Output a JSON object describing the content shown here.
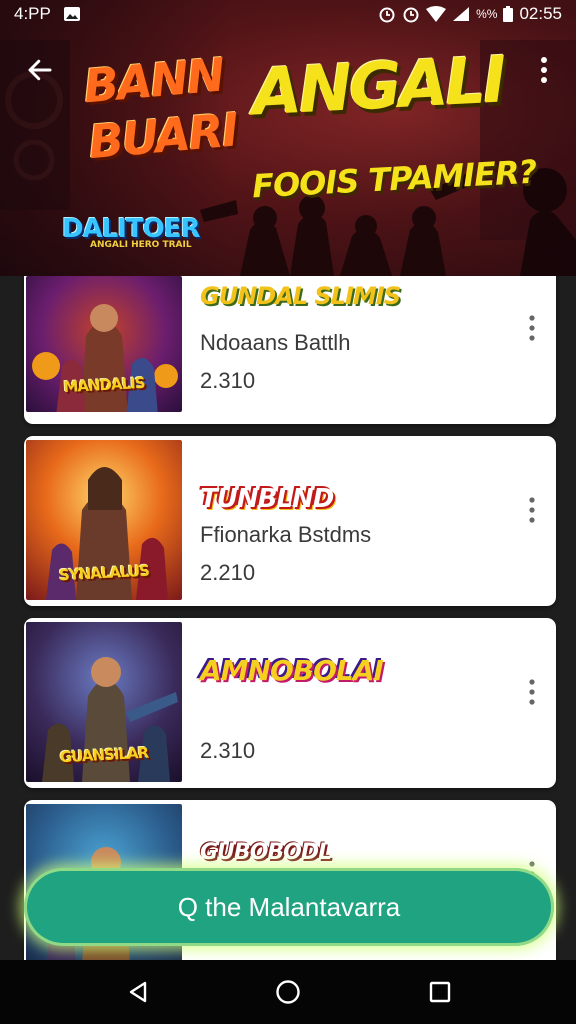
{
  "status_bar": {
    "time_left": "4:PP",
    "battery_text": "%%",
    "clock": "02:55"
  },
  "banner": {
    "title_line1": "BANN",
    "title_line2": "BUARI",
    "title_big": "ANGALI",
    "subtitle": "FOOIS TPAMIER?",
    "logo": "DALITOER",
    "logo_sub": "ANGALI HERO TRAIL"
  },
  "games": [
    {
      "thumb_caption": "MANDALIS",
      "logo_text": "GUNDAL SLIMIS",
      "title": "Ndoaans Battlh",
      "count": "2.310"
    },
    {
      "thumb_caption": "SYNALALUS",
      "logo_text": "TUNBLND",
      "title": "Ffionarka Bstdms",
      "count": "2.210"
    },
    {
      "thumb_caption": "GUANSILAR",
      "logo_text": "AMNOBOLAI",
      "title": "",
      "count": "2.310"
    },
    {
      "thumb_caption": "",
      "logo_text": "GUBOBODL",
      "title": "",
      "count": ""
    }
  ],
  "cta": {
    "label": "Q the Malantavarra"
  },
  "colors": {
    "accent": "#1fa380",
    "banner": "#5b1619",
    "title_yellow": "#f5e21b",
    "title_orange": "#ff6a1c"
  },
  "icons": {
    "back": "arrow-left-icon",
    "more": "more-vert-icon",
    "card_menu": "more-vert-icon",
    "nav_back": "triangle-back-icon",
    "nav_home": "circle-home-icon",
    "nav_recents": "square-recents-icon"
  }
}
